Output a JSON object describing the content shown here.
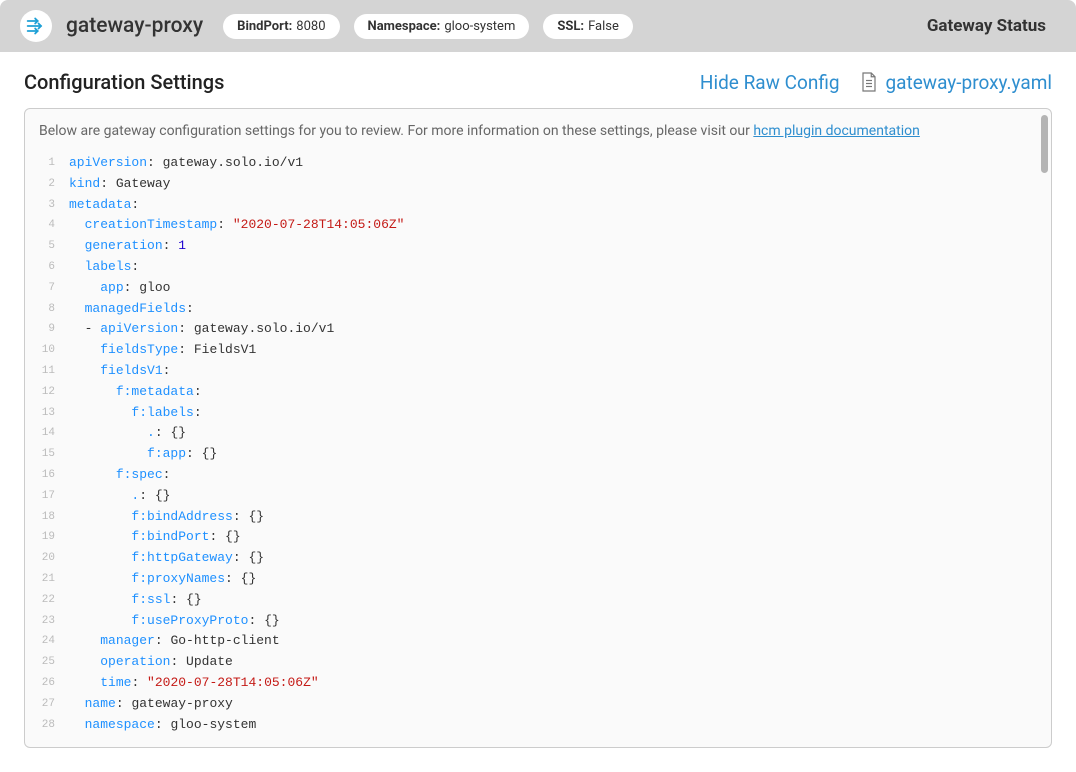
{
  "header": {
    "title": "gateway-proxy",
    "pills": [
      {
        "label": "BindPort:",
        "value": "8080"
      },
      {
        "label": "Namespace:",
        "value": "gloo-system"
      },
      {
        "label": "SSL:",
        "value": "False"
      }
    ],
    "status": "Gateway Status"
  },
  "subheader": {
    "title": "Configuration Settings",
    "hide_raw": "Hide Raw Config",
    "filename": "gateway-proxy.yaml"
  },
  "panel": {
    "desc_prefix": "Below are gateway configuration settings for you to review. For more information on these settings, please visit our ",
    "desc_link": "hcm plugin documentation"
  },
  "code": [
    [
      {
        "t": "key",
        "v": "apiVersion"
      },
      {
        "t": "punc",
        "v": ": "
      },
      {
        "t": "plain",
        "v": "gateway.solo.io/v1"
      }
    ],
    [
      {
        "t": "key",
        "v": "kind"
      },
      {
        "t": "punc",
        "v": ": "
      },
      {
        "t": "plain",
        "v": "Gateway"
      }
    ],
    [
      {
        "t": "key",
        "v": "metadata"
      },
      {
        "t": "punc",
        "v": ":"
      }
    ],
    [
      {
        "t": "plain",
        "v": "  "
      },
      {
        "t": "key",
        "v": "creationTimestamp"
      },
      {
        "t": "punc",
        "v": ": "
      },
      {
        "t": "str",
        "v": "\"2020-07-28T14:05:06Z\""
      }
    ],
    [
      {
        "t": "plain",
        "v": "  "
      },
      {
        "t": "key",
        "v": "generation"
      },
      {
        "t": "punc",
        "v": ": "
      },
      {
        "t": "num",
        "v": "1"
      }
    ],
    [
      {
        "t": "plain",
        "v": "  "
      },
      {
        "t": "key",
        "v": "labels"
      },
      {
        "t": "punc",
        "v": ":"
      }
    ],
    [
      {
        "t": "plain",
        "v": "    "
      },
      {
        "t": "key",
        "v": "app"
      },
      {
        "t": "punc",
        "v": ": "
      },
      {
        "t": "plain",
        "v": "gloo"
      }
    ],
    [
      {
        "t": "plain",
        "v": "  "
      },
      {
        "t": "key",
        "v": "managedFields"
      },
      {
        "t": "punc",
        "v": ":"
      }
    ],
    [
      {
        "t": "plain",
        "v": "  "
      },
      {
        "t": "punc",
        "v": "- "
      },
      {
        "t": "key",
        "v": "apiVersion"
      },
      {
        "t": "punc",
        "v": ": "
      },
      {
        "t": "plain",
        "v": "gateway.solo.io/v1"
      }
    ],
    [
      {
        "t": "plain",
        "v": "    "
      },
      {
        "t": "key",
        "v": "fieldsType"
      },
      {
        "t": "punc",
        "v": ": "
      },
      {
        "t": "plain",
        "v": "FieldsV1"
      }
    ],
    [
      {
        "t": "plain",
        "v": "    "
      },
      {
        "t": "key",
        "v": "fieldsV1"
      },
      {
        "t": "punc",
        "v": ":"
      }
    ],
    [
      {
        "t": "plain",
        "v": "      "
      },
      {
        "t": "key",
        "v": "f:metadata"
      },
      {
        "t": "punc",
        "v": ":"
      }
    ],
    [
      {
        "t": "plain",
        "v": "        "
      },
      {
        "t": "key",
        "v": "f:labels"
      },
      {
        "t": "punc",
        "v": ":"
      }
    ],
    [
      {
        "t": "plain",
        "v": "          "
      },
      {
        "t": "key",
        "v": "."
      },
      {
        "t": "punc",
        "v": ": "
      },
      {
        "t": "punc",
        "v": "{}"
      }
    ],
    [
      {
        "t": "plain",
        "v": "          "
      },
      {
        "t": "key",
        "v": "f:app"
      },
      {
        "t": "punc",
        "v": ": "
      },
      {
        "t": "punc",
        "v": "{}"
      }
    ],
    [
      {
        "t": "plain",
        "v": "      "
      },
      {
        "t": "key",
        "v": "f:spec"
      },
      {
        "t": "punc",
        "v": ":"
      }
    ],
    [
      {
        "t": "plain",
        "v": "        "
      },
      {
        "t": "key",
        "v": "."
      },
      {
        "t": "punc",
        "v": ": "
      },
      {
        "t": "punc",
        "v": "{}"
      }
    ],
    [
      {
        "t": "plain",
        "v": "        "
      },
      {
        "t": "key",
        "v": "f:bindAddress"
      },
      {
        "t": "punc",
        "v": ": "
      },
      {
        "t": "punc",
        "v": "{}"
      }
    ],
    [
      {
        "t": "plain",
        "v": "        "
      },
      {
        "t": "key",
        "v": "f:bindPort"
      },
      {
        "t": "punc",
        "v": ": "
      },
      {
        "t": "punc",
        "v": "{}"
      }
    ],
    [
      {
        "t": "plain",
        "v": "        "
      },
      {
        "t": "key",
        "v": "f:httpGateway"
      },
      {
        "t": "punc",
        "v": ": "
      },
      {
        "t": "punc",
        "v": "{}"
      }
    ],
    [
      {
        "t": "plain",
        "v": "        "
      },
      {
        "t": "key",
        "v": "f:proxyNames"
      },
      {
        "t": "punc",
        "v": ": "
      },
      {
        "t": "punc",
        "v": "{}"
      }
    ],
    [
      {
        "t": "plain",
        "v": "        "
      },
      {
        "t": "key",
        "v": "f:ssl"
      },
      {
        "t": "punc",
        "v": ": "
      },
      {
        "t": "punc",
        "v": "{}"
      }
    ],
    [
      {
        "t": "plain",
        "v": "        "
      },
      {
        "t": "key",
        "v": "f:useProxyProto"
      },
      {
        "t": "punc",
        "v": ": "
      },
      {
        "t": "punc",
        "v": "{}"
      }
    ],
    [
      {
        "t": "plain",
        "v": "    "
      },
      {
        "t": "key",
        "v": "manager"
      },
      {
        "t": "punc",
        "v": ": "
      },
      {
        "t": "plain",
        "v": "Go-http-client"
      }
    ],
    [
      {
        "t": "plain",
        "v": "    "
      },
      {
        "t": "key",
        "v": "operation"
      },
      {
        "t": "punc",
        "v": ": "
      },
      {
        "t": "plain",
        "v": "Update"
      }
    ],
    [
      {
        "t": "plain",
        "v": "    "
      },
      {
        "t": "key",
        "v": "time"
      },
      {
        "t": "punc",
        "v": ": "
      },
      {
        "t": "str",
        "v": "\"2020-07-28T14:05:06Z\""
      }
    ],
    [
      {
        "t": "plain",
        "v": "  "
      },
      {
        "t": "key",
        "v": "name"
      },
      {
        "t": "punc",
        "v": ": "
      },
      {
        "t": "plain",
        "v": "gateway-proxy"
      }
    ],
    [
      {
        "t": "plain",
        "v": "  "
      },
      {
        "t": "key",
        "v": "namespace"
      },
      {
        "t": "punc",
        "v": ": "
      },
      {
        "t": "plain",
        "v": "gloo-system"
      }
    ]
  ]
}
